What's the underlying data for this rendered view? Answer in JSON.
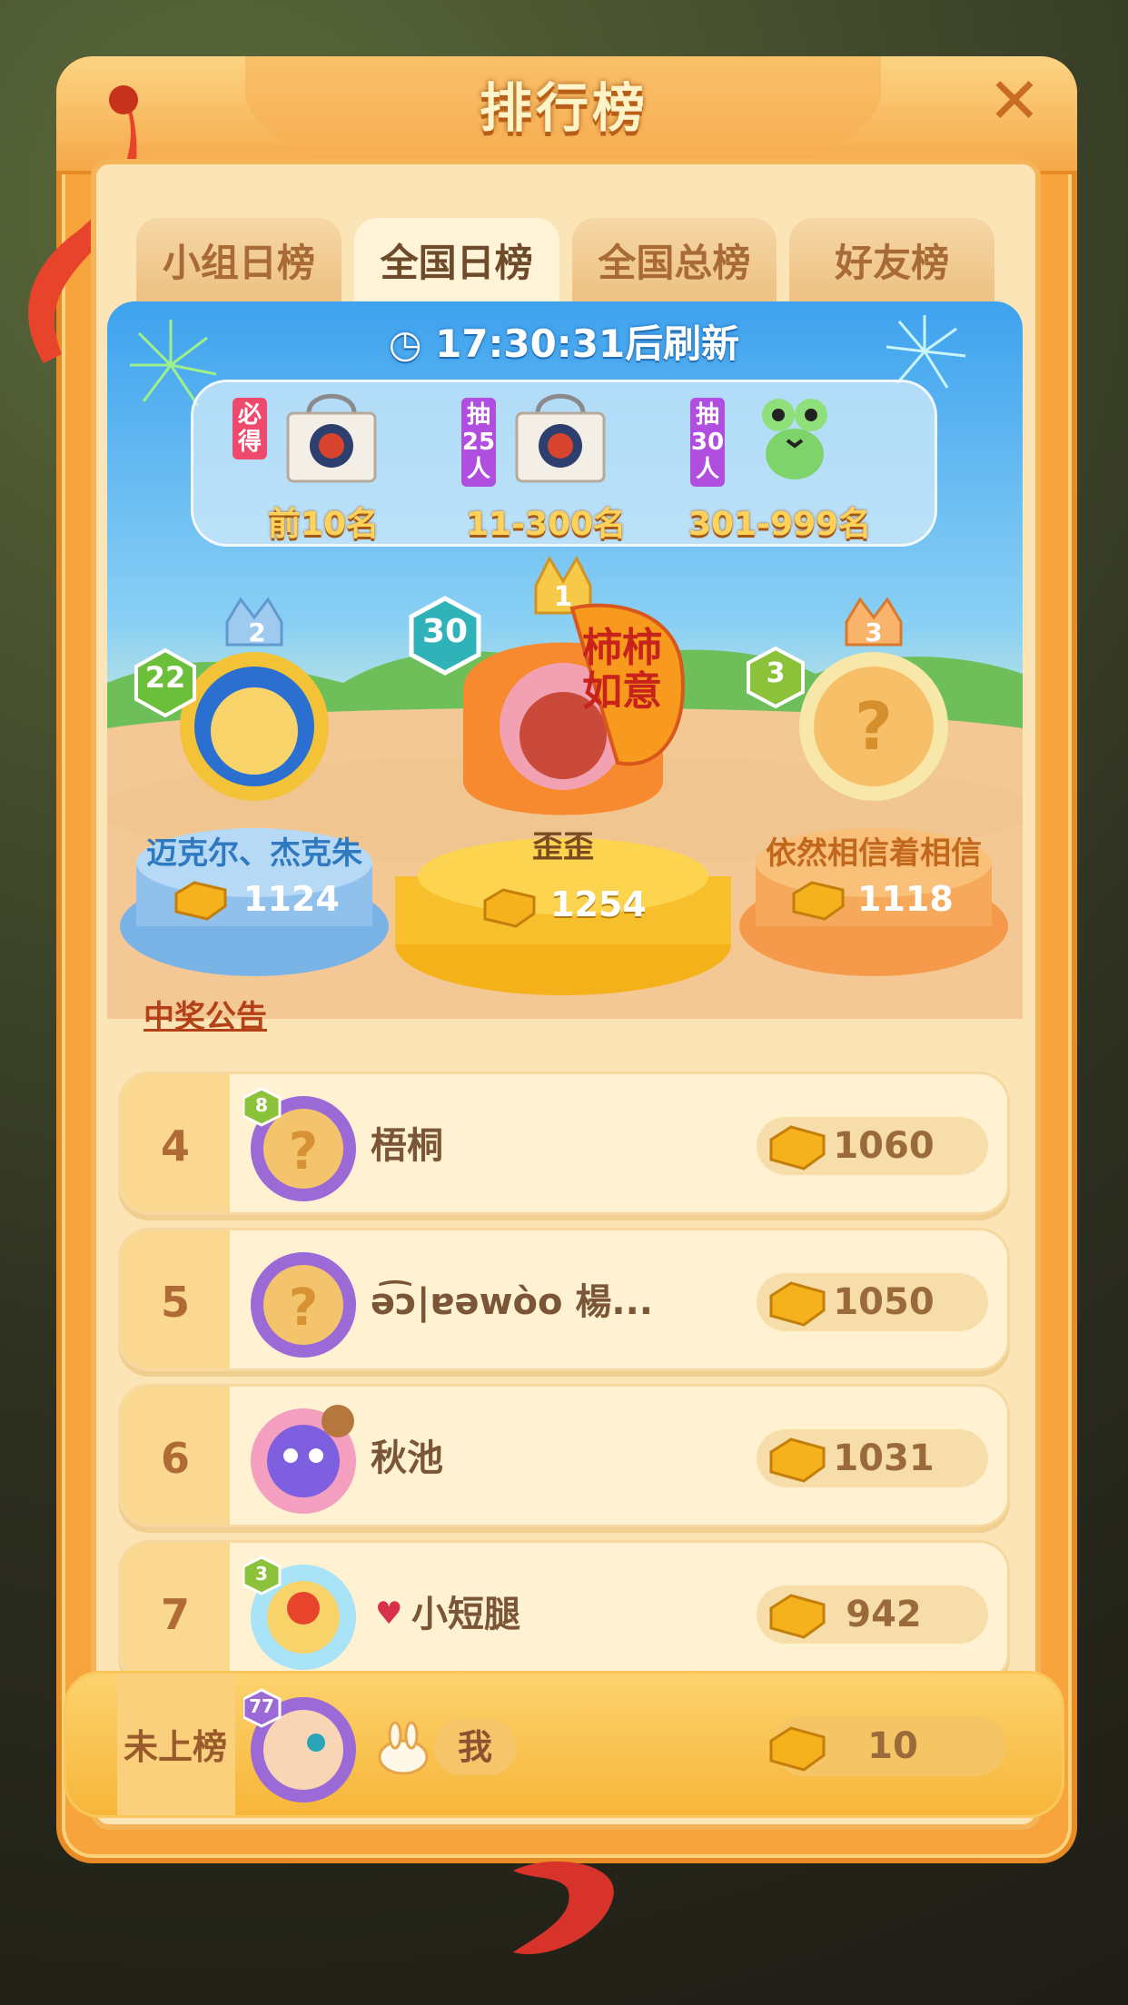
{
  "header": {
    "title": "排行榜"
  },
  "tabs": [
    {
      "label": "小组日榜",
      "active": false
    },
    {
      "label": "全国日榜",
      "active": true
    },
    {
      "label": "全国总榜",
      "active": false
    },
    {
      "label": "好友榜",
      "active": false
    }
  ],
  "timer": {
    "time": "17:30:31",
    "suffix": "后刷新"
  },
  "prizes": [
    {
      "tag": "必得",
      "label": "前10名"
    },
    {
      "tag": "抽25人",
      "label": "11-300名"
    },
    {
      "tag": "抽30人",
      "label": "301-999名"
    }
  ],
  "podium": {
    "first": {
      "rank": "1",
      "level": "30",
      "name": "歪歪",
      "score": "1254",
      "badge_text": "柿柿如意"
    },
    "second": {
      "rank": "2",
      "level": "22",
      "name": "迈克尔、杰克朱",
      "score": "1124"
    },
    "third": {
      "rank": "3",
      "level": "3",
      "name": "依然相信着相信",
      "score": "1118"
    }
  },
  "announce_label": "中奖公告",
  "rows": [
    {
      "rank": "4",
      "name": "梧桐",
      "score": "1060",
      "level": "8"
    },
    {
      "rank": "5",
      "name": "ǝ͡ɔ|ɐǝwòo 楊...",
      "score": "1050",
      "level": ""
    },
    {
      "rank": "6",
      "name": "秋池",
      "score": "1031",
      "level": ""
    },
    {
      "rank": "7",
      "name": "小短腿",
      "score": "942",
      "level": "3"
    }
  ],
  "me": {
    "rank_label": "未上榜",
    "name": "我",
    "score": "10",
    "level": "77"
  },
  "colors": {
    "accent": "#f7a43c",
    "sky": "#3ea2ee",
    "gold": "#f5b21d"
  }
}
